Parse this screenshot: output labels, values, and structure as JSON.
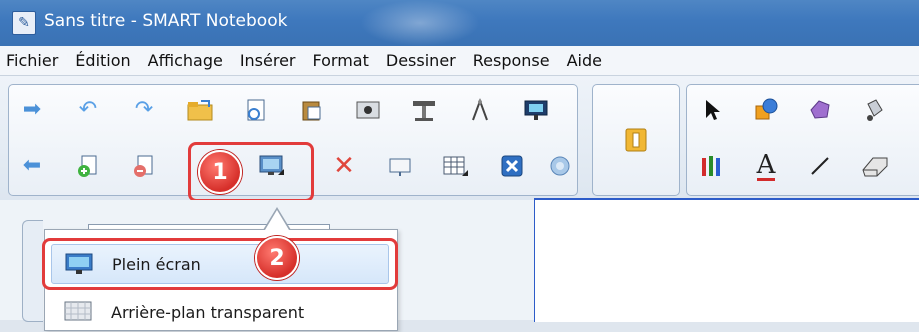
{
  "window": {
    "title": "Sans titre - SMART Notebook"
  },
  "menu": [
    "Fichier",
    "Édition",
    "Affichage",
    "Insérer",
    "Format",
    "Dessiner",
    "Response",
    "Aide"
  ],
  "toolbar": {
    "row1_icons": [
      "arrow-right-icon",
      "undo-icon",
      "redo-icon",
      "open-folder-icon",
      "new-page-icon",
      "paste-icon",
      "screenshot-icon",
      "document-camera-icon",
      "geometry-tool-icon",
      "projector-icon"
    ],
    "row2_icons": [
      "arrow-left-icon",
      "add-page-icon",
      "delete-page-icon",
      "screen-shade-icon",
      "full-screen-icon",
      "delete-icon",
      "table-icon",
      "cancel-icon",
      "capture-icon"
    ]
  },
  "annotations": {
    "step1": "1",
    "step2": "2",
    "accent": "#e23b3b"
  },
  "dropdown": {
    "items": [
      {
        "label": "Plein écran",
        "icon": "monitor-icon",
        "highlighted": true
      },
      {
        "label": "Arrière-plan transparent",
        "icon": "transparent-background-icon",
        "highlighted": false
      }
    ]
  }
}
